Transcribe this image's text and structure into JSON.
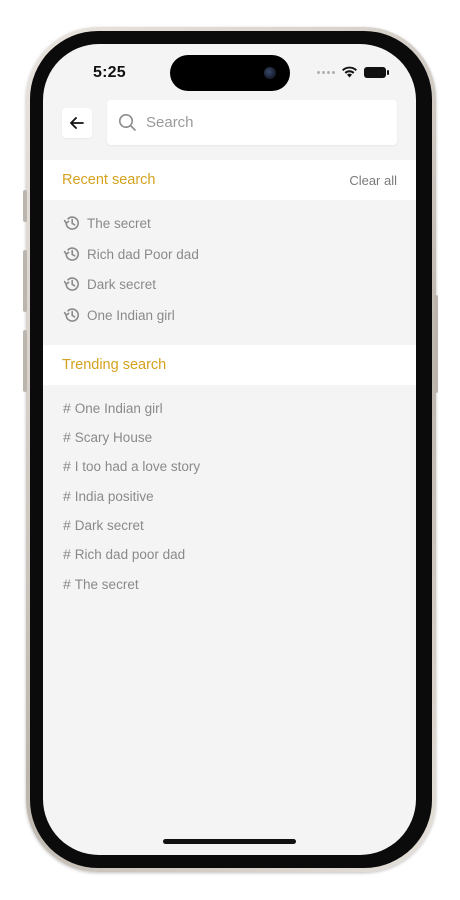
{
  "status_bar": {
    "time": "5:25"
  },
  "search": {
    "placeholder": "Search"
  },
  "recent": {
    "title": "Recent search",
    "clear_label": "Clear all",
    "items": [
      {
        "label": "The secret"
      },
      {
        "label": "Rich dad Poor dad"
      },
      {
        "label": "Dark secret"
      },
      {
        "label": "One Indian girl"
      }
    ]
  },
  "trending": {
    "title": "Trending search",
    "prefix": "#",
    "items": [
      {
        "label": "One Indian girl"
      },
      {
        "label": "Scary House"
      },
      {
        "label": "I too had a love story"
      },
      {
        "label": "India positive"
      },
      {
        "label": "Dark secret"
      },
      {
        "label": "Rich dad poor dad"
      },
      {
        "label": "The secret"
      }
    ]
  },
  "colors": {
    "accent": "#d4a21f",
    "background": "#f4f4f4",
    "item_text": "#8a8a8a"
  }
}
